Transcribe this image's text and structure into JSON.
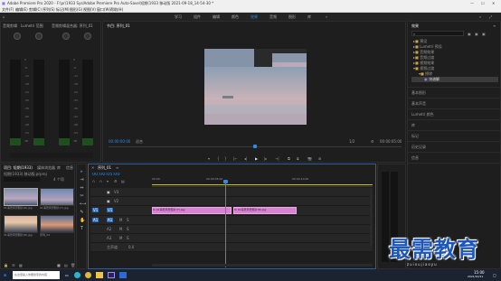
{
  "app": {
    "title": "Adobe Premiere Pro 2020 - F:\\pr\\1933 SyslAdobe Premiere Pro Auto-Save\\短期(1933 移动版 2021-09-18_14-54-30 *"
  },
  "window_controls": {
    "minimize": "—",
    "maximize": "☐",
    "close": "✕"
  },
  "menu": [
    "文件(F)",
    "编辑(E)",
    "剪辑(C)",
    "序列(S)",
    "标记(M)",
    "图形(G)",
    "视图(V)",
    "窗口(W)",
    "帮助(H)"
  ],
  "workspaces": {
    "items": [
      "学习",
      "组件",
      "编辑",
      "颜色",
      "效果",
      "音频",
      "图形",
      "库"
    ],
    "active": "效果"
  },
  "audio_mixer": {
    "title_left": "音频剪辑",
    "track_a": "Lumetri 范围",
    "track_b": "音频剪辑混合器: 序列_01",
    "scale": [
      "0",
      "-6",
      "-12",
      "-18",
      "-24",
      "-30",
      "-36",
      "-42",
      "-48",
      "-54",
      "dB"
    ]
  },
  "program_monitor": {
    "title": "节目: 序列_01",
    "timecode_left": "00:00:00:00",
    "fit": "适合",
    "ratio": "1/2",
    "timecode_right": "00:00:05:00",
    "controls": [
      "▾",
      "{",
      "}",
      "|←",
      "◂|",
      "▶",
      "|▸",
      "→|",
      "⧉",
      "⧈",
      "📷",
      "⊞",
      "+"
    ]
  },
  "effects_panel": {
    "title": "效果",
    "search_placeholder": "",
    "tree": [
      {
        "label": "预设",
        "indent": 0
      },
      {
        "label": "Lumetri 预设",
        "indent": 0
      },
      {
        "label": "音频效果",
        "indent": 0
      },
      {
        "label": "音频过渡",
        "indent": 0
      },
      {
        "label": "视频效果",
        "indent": 0
      },
      {
        "label": "视频过渡",
        "indent": 0
      },
      {
        "label": "擦除",
        "indent": 1
      },
      {
        "label": "块溶解",
        "indent": 2,
        "selected": true
      }
    ],
    "sections": [
      "基本图形",
      "基本声音",
      "Lumetri 颜色",
      "库",
      "标记",
      "历史记录",
      "信息"
    ]
  },
  "project_panel": {
    "tabs": [
      "项目: 短期(1933)",
      "媒体浏览器",
      "库",
      "信息"
    ],
    "path": "短期(1933) 移动版.prproj",
    "count": "4 个项",
    "items": [
      {
        "name": "01海景风景照片(6).jpg",
        "dur": "5:00"
      },
      {
        "name": "01海景风景照片(7).jpg",
        "dur": "5:00"
      },
      {
        "name": "01海景风景照片(8).jpg",
        "dur": "5:00"
      },
      {
        "name": "序列_01",
        "dur": "10:00"
      }
    ]
  },
  "timeline": {
    "title": "序列_01",
    "timecode": "00:00:05:00",
    "ruler": [
      "00:00",
      "00:00:05:00",
      "00:00:10:00"
    ],
    "video_tracks": [
      "V3",
      "V2",
      "V1"
    ],
    "audio_tracks": [
      "A1",
      "A2",
      "A3"
    ],
    "master": "主声道",
    "master_value": "0.0",
    "clips": [
      {
        "label": "fx 01海景风景照片(7).jpg"
      },
      {
        "label": "fx 01海景风景照片(8).jpg"
      }
    ]
  },
  "tools": [
    "▸",
    "⇥",
    "⇔",
    "✂",
    "⟷",
    "✎",
    "✋",
    "T"
  ],
  "taskbar": {
    "search": "在这里输入你要搜索的内容",
    "time": "15:00",
    "date": "2021/10/11",
    "icons": [
      {
        "name": "windows-icon",
        "color": "#4fa3ff"
      },
      {
        "name": "task-view-icon",
        "color": "#ffffff"
      },
      {
        "name": "edge-icon",
        "color": "#2fb3c8"
      },
      {
        "name": "chrome-icon",
        "color": "#e2b63a"
      },
      {
        "name": "explorer-icon",
        "color": "#f0c24a"
      },
      {
        "name": "premiere-icon",
        "color": "#9f8cff"
      },
      {
        "name": "word-icon",
        "color": "#2b6bd8"
      }
    ]
  },
  "watermark": {
    "text": "最需教育",
    "sub": "zuixujiaoyu"
  }
}
